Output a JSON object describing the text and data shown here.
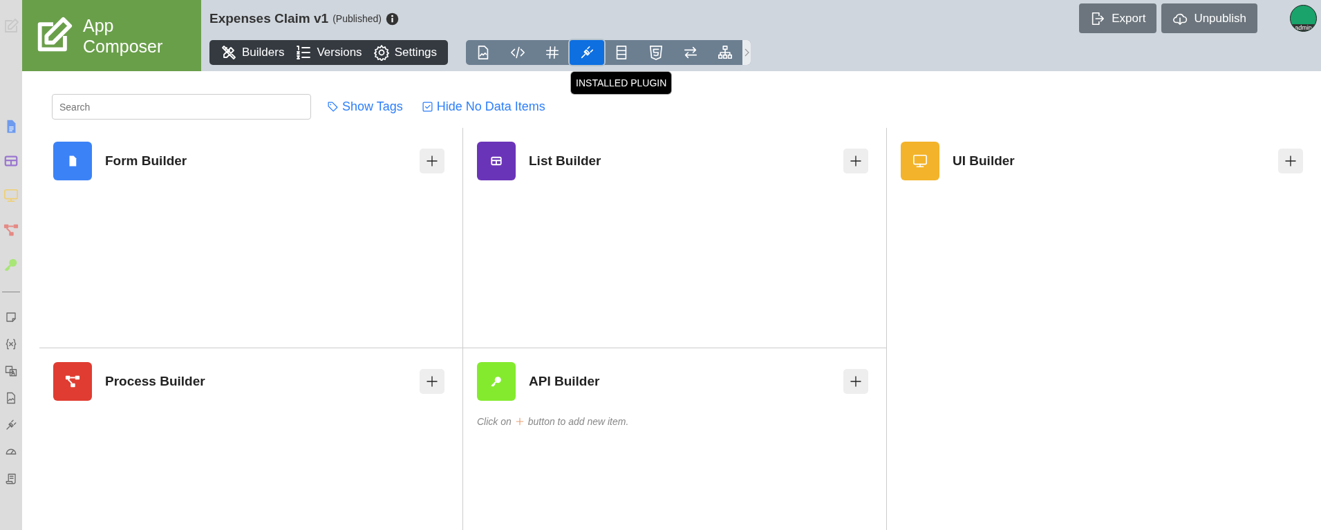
{
  "sidebar": {
    "items": [
      {
        "kind": "form",
        "color": "#6f9bee"
      },
      {
        "kind": "list",
        "color": "#9a77cf"
      },
      {
        "kind": "ui",
        "color": "#efcf70"
      },
      {
        "kind": "process",
        "color": "#e58a85"
      },
      {
        "kind": "api",
        "color": "#a8e676"
      },
      {
        "kind": "divider"
      },
      {
        "kind": "note"
      },
      {
        "kind": "variable"
      },
      {
        "kind": "translate"
      },
      {
        "kind": "file-image"
      },
      {
        "kind": "plug"
      },
      {
        "kind": "gauge"
      },
      {
        "kind": "scroll"
      }
    ]
  },
  "logo": {
    "title": "App Composer"
  },
  "app": {
    "name": "Expenses Claim v1",
    "status": "(Published)"
  },
  "nav": [
    {
      "kind": "builders",
      "label": "Builders"
    },
    {
      "kind": "versions",
      "label": "Versions"
    },
    {
      "kind": "settings",
      "label": "Settings"
    }
  ],
  "tools": [
    {
      "kind": "file-image",
      "selected": false
    },
    {
      "kind": "code",
      "selected": false
    },
    {
      "kind": "hash",
      "selected": false
    },
    {
      "kind": "plug",
      "selected": true
    },
    {
      "kind": "rows",
      "selected": false
    },
    {
      "kind": "html5",
      "selected": false
    },
    {
      "kind": "exchange",
      "selected": false
    },
    {
      "kind": "sitemap",
      "selected": false
    }
  ],
  "tooltip": "INSTALLED PLUGIN",
  "actions": [
    {
      "kind": "export",
      "label": "Export"
    },
    {
      "kind": "unpublish",
      "label": "Unpublish"
    }
  ],
  "avatar": {
    "label": "admin"
  },
  "search": {
    "placeholder": "Search"
  },
  "filters": [
    {
      "kind": "tag",
      "label": "Show Tags"
    },
    {
      "kind": "check",
      "label": "Hide No Data Items"
    }
  ],
  "columns": [
    [
      {
        "kind": "form",
        "title": "Form Builder",
        "color": "#3b82f6"
      },
      {
        "kind": "process",
        "title": "Process Builder",
        "color": "#e03c31"
      }
    ],
    [
      {
        "kind": "list",
        "title": "List Builder",
        "color": "#6a34b8"
      },
      {
        "kind": "api",
        "title": "API Builder",
        "color": "#84ea2e",
        "hint_before": "Click on",
        "hint_after": "button to add new item."
      }
    ],
    [
      {
        "kind": "ui",
        "title": "UI Builder",
        "color": "#f3b42b"
      }
    ]
  ]
}
